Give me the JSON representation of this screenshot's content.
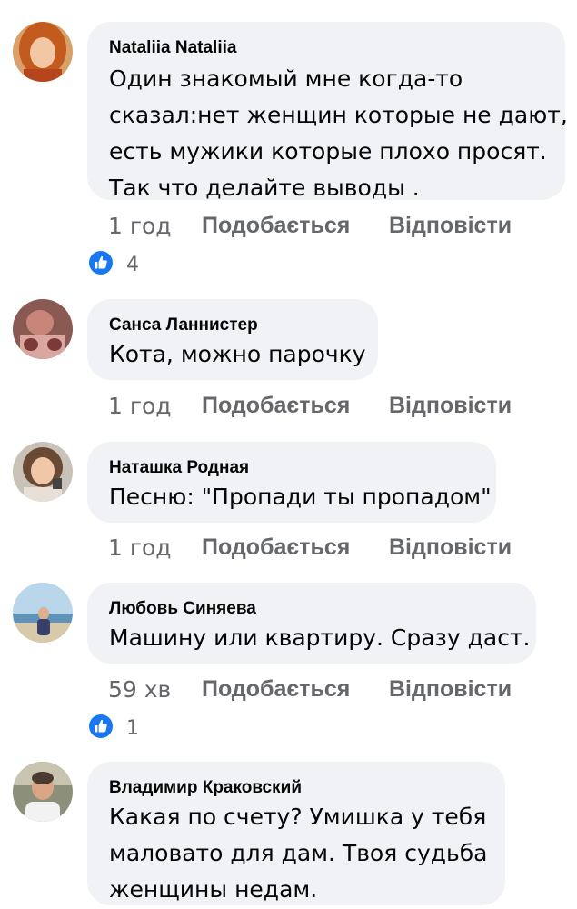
{
  "comments": [
    {
      "author": "Nataliia Nataliia",
      "lines": [
        "Один знакомый мне когда-то",
        "сказал:нет женщин которые не дают,",
        "есть мужики которые плохо просят.",
        "Так что делайте выводы ."
      ],
      "time": "1 год",
      "like_label": "Подобається",
      "reply_label": "Відповісти",
      "reactions": "4"
    },
    {
      "author": "Санса Ланнистер",
      "lines": [
        "Кота, можно парочку"
      ],
      "time": "1 год",
      "like_label": "Подобається",
      "reply_label": "Відповісти"
    },
    {
      "author": "Наташка Родная",
      "lines": [
        "Песню: \"Пропади ты пропадом\""
      ],
      "time": "1 год",
      "like_label": "Подобається",
      "reply_label": "Відповісти"
    },
    {
      "author": "Любовь Синяева",
      "lines": [
        "Машину или квартиру. Сразу даст."
      ],
      "time": "59 хв",
      "like_label": "Подобається",
      "reply_label": "Відповісти",
      "reactions": "1"
    },
    {
      "author": "Владимир Краковский",
      "lines": [
        "Какая по счету? Умишка у тебя",
        "маловато для дам. Твоя судьба",
        "женщины недам."
      ]
    }
  ],
  "colors": {
    "bubble": "#f0f2f5",
    "meta": "#65676b",
    "like_badge": "#1877f2"
  },
  "icons": {
    "like_badge": "thumbs-up-icon"
  }
}
